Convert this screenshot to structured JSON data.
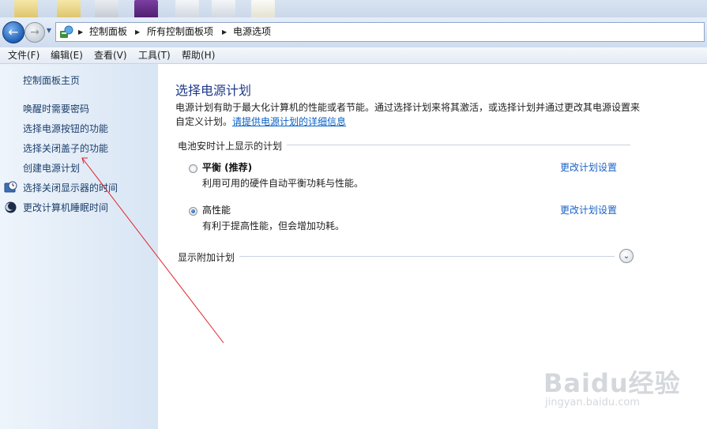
{
  "breadcrumb": [
    "控制面板",
    "所有控制面板项",
    "电源选项"
  ],
  "menu": [
    "文件(F)",
    "编辑(E)",
    "查看(V)",
    "工具(T)",
    "帮助(H)"
  ],
  "sidebar": {
    "home": "控制面板主页",
    "tasks": [
      "唤醒时需要密码",
      "选择电源按钮的功能",
      "选择关闭盖子的功能",
      "创建电源计划",
      "选择关闭显示器的时间",
      "更改计算机睡眠时间"
    ]
  },
  "main": {
    "title": "选择电源计划",
    "desc_text": "电源计划有助于最大化计算机的性能或者节能。通过选择计划来将其激活，或选择计划并通过更改其电源设置来自定义计划。",
    "desc_link": "请提供电源计划的详细信息",
    "section_label": "电池安时计上显示的计划",
    "plans": [
      {
        "name": "平衡 (推荐)",
        "desc": "利用可用的硬件自动平衡功耗与性能。",
        "link": "更改计划设置",
        "selected": false
      },
      {
        "name": "高性能",
        "desc": "有利于提高性能，但会增加功耗。",
        "link": "更改计划设置",
        "selected": true
      }
    ],
    "more_plans_label": "显示附加计划"
  },
  "watermark": {
    "text": "Baidu经验",
    "sub": "jingyan.baidu.com"
  },
  "colors": {
    "link": "#1a63c6",
    "title": "#1e3a8a",
    "annotation_arrow": "#e0242a"
  }
}
